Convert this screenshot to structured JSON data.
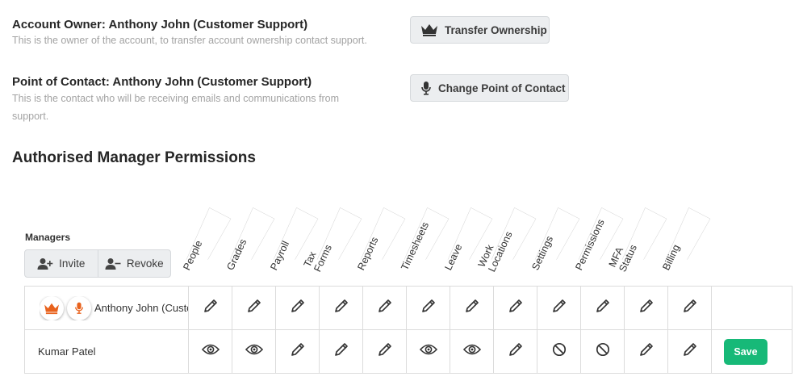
{
  "owner": {
    "title": "Account Owner: Anthony John (Customer Support)",
    "description": "This is the owner of the account, to transfer account ownership contact support.",
    "button_label": "Transfer Ownership",
    "button_icon": "crown-icon"
  },
  "contact": {
    "title": "Point of Contact: Anthony John (Customer Support)",
    "description": "This is the contact who will be receiving emails and communications from support.",
    "button_label": "Change Point of Contact",
    "button_icon": "microphone-icon"
  },
  "permissions": {
    "section_title": "Authorised Manager Permissions",
    "managers_label": "Managers",
    "invite_label": "Invite",
    "revoke_label": "Revoke",
    "columns": [
      "People",
      "Grades",
      "Payroll",
      "Tax Forms",
      "Reports",
      "Timesheets",
      "Leave",
      "Work Locations",
      "Settings",
      "Permissions",
      "MFA Status",
      "Billing"
    ],
    "rows": [
      {
        "name": "Anthony John (Customer Support)",
        "badges": [
          "crown-icon",
          "microphone-icon"
        ],
        "cells": [
          "edit",
          "edit",
          "edit",
          "edit",
          "edit",
          "edit",
          "edit",
          "edit",
          "edit",
          "edit",
          "edit",
          "edit"
        ],
        "action": ""
      },
      {
        "name": "Kumar Patel",
        "badges": [],
        "cells": [
          "view",
          "view",
          "edit",
          "edit",
          "edit",
          "view",
          "view",
          "edit",
          "none",
          "none",
          "edit",
          "edit"
        ],
        "action": "Save"
      }
    ]
  },
  "colors": {
    "accent_orange": "#e8621d",
    "save_green": "#17b978",
    "muted_text": "#a3a3a3"
  }
}
